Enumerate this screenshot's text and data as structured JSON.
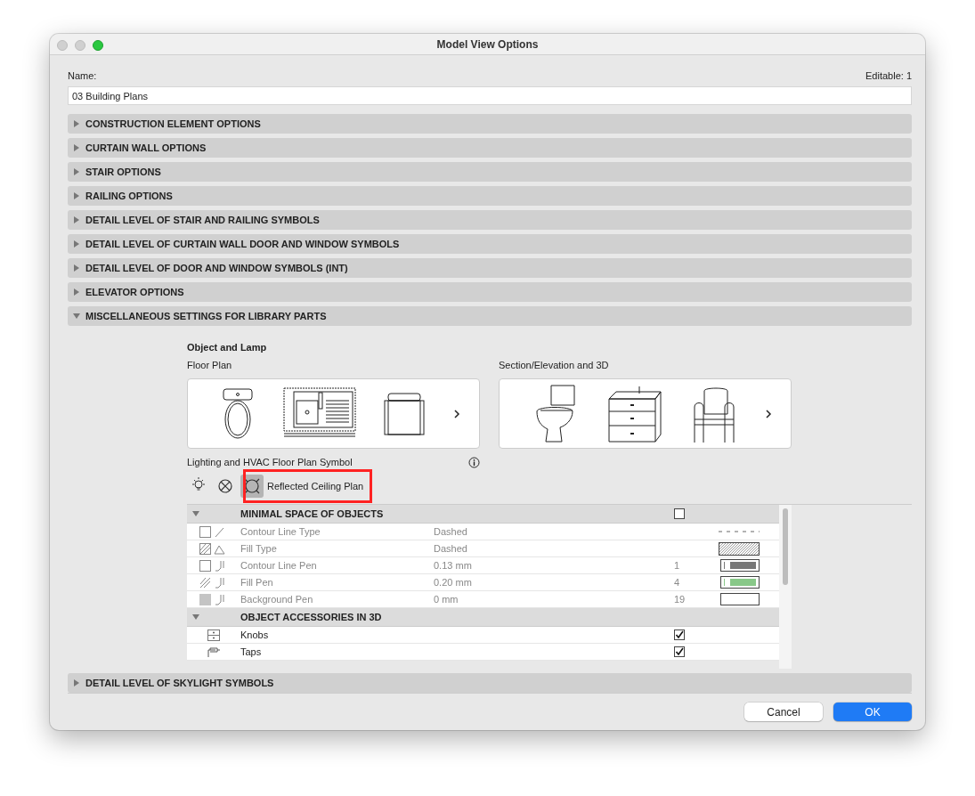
{
  "window": {
    "title": "Model View Options"
  },
  "name_label": "Name:",
  "editable": "Editable: 1",
  "name_value": "03 Building Plans",
  "sections_before": [
    {
      "title": "CONSTRUCTION ELEMENT OPTIONS",
      "expanded": false
    },
    {
      "title": "CURTAIN WALL OPTIONS",
      "expanded": false
    },
    {
      "title": "STAIR OPTIONS",
      "expanded": false
    },
    {
      "title": "RAILING OPTIONS",
      "expanded": false
    },
    {
      "title": "DETAIL LEVEL OF STAIR AND RAILING SYMBOLS",
      "expanded": false
    },
    {
      "title": "DETAIL LEVEL OF CURTAIN WALL DOOR AND WINDOW SYMBOLS",
      "expanded": false
    },
    {
      "title": "DETAIL LEVEL OF DOOR AND WINDOW SYMBOLS (INT)",
      "expanded": false
    },
    {
      "title": "ELEVATOR OPTIONS",
      "expanded": false
    },
    {
      "title": "MISCELLANEOUS SETTINGS FOR LIBRARY PARTS",
      "expanded": true
    }
  ],
  "misc_panel": {
    "subtitle": "Object and Lamp",
    "floor_plan_label": "Floor Plan",
    "section_label": "Section/Elevation and 3D",
    "lighting_label": "Lighting and HVAC Floor Plan Symbol",
    "symbols": [
      {
        "kind": "bulb",
        "selected": false
      },
      {
        "kind": "cross",
        "selected": false
      },
      {
        "kind": "ceiling",
        "selected": true
      }
    ],
    "symbol_caption": "Reflected Ceiling Plan",
    "groups": [
      {
        "title": "MINIMAL SPACE OF OBJECTS",
        "expanded": true,
        "checked": false,
        "rows": [
          {
            "kind": "line_type",
            "name": "Contour Line Type",
            "value": "Dashed",
            "disabled": true
          },
          {
            "kind": "fill_type",
            "name": "Fill Type",
            "value": "Dashed",
            "disabled": true
          },
          {
            "kind": "pen",
            "name": "Contour Line Pen",
            "value": "0.13 mm",
            "pen": "1",
            "color": "#777777",
            "disabled": true
          },
          {
            "kind": "fill_pen",
            "name": "Fill Pen",
            "value": "0.20 mm",
            "pen": "4",
            "color": "#88c888",
            "disabled": true
          },
          {
            "kind": "bg_pen",
            "name": "Background Pen",
            "value": "0 mm",
            "pen": "19",
            "color": "#ffffff",
            "disabled": true
          }
        ]
      },
      {
        "title": "OBJECT ACCESSORIES IN 3D",
        "expanded": true,
        "rows": [
          {
            "kind": "knobs",
            "name": "Knobs",
            "checked": true,
            "disabled": false
          },
          {
            "kind": "taps",
            "name": "Taps",
            "checked": true,
            "disabled": false
          }
        ]
      }
    ]
  },
  "sections_after": [
    {
      "title": "DETAIL LEVEL OF SKYLIGHT SYMBOLS",
      "expanded": false
    }
  ],
  "buttons": [
    {
      "label": "Cancel",
      "kind": "secondary"
    },
    {
      "label": "OK",
      "kind": "primary"
    }
  ]
}
